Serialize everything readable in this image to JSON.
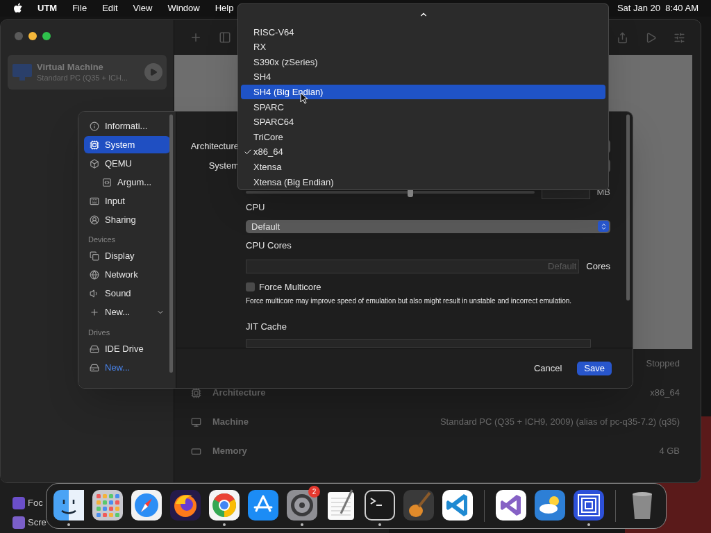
{
  "menu_bar": {
    "app": "UTM",
    "menus": [
      "File",
      "Edit",
      "View",
      "Window",
      "Help"
    ],
    "clock": "Sat Jan 20  8:40 AM"
  },
  "vm_list": [
    {
      "name": "Virtual Machine",
      "subtitle": "Standard PC (Q35 + ICH...",
      "selected": true
    }
  ],
  "vm_details": {
    "status": "Stopped",
    "rows": [
      {
        "kind": "chip",
        "label": "Architecture",
        "value": "x86_64"
      },
      {
        "kind": "monitor",
        "label": "Machine",
        "value": "Standard PC (Q35 + ICH9, 2009) (alias of pc-q35-7.2) (q35)"
      },
      {
        "kind": "memory",
        "label": "Memory",
        "value": "4 GB"
      }
    ]
  },
  "settings_sidebar": [
    {
      "items": [
        {
          "kind": "info",
          "label": "Informati...",
          "selected": false
        },
        {
          "kind": "chip",
          "label": "System",
          "selected": true
        },
        {
          "kind": "cube",
          "label": "QEMU",
          "selected": false,
          "children": [
            {
              "kind": "args",
              "label": "Argum...",
              "selected": false
            }
          ]
        },
        {
          "kind": "keyboard",
          "label": "Input",
          "selected": false
        },
        {
          "kind": "person",
          "label": "Sharing",
          "selected": false
        }
      ]
    },
    {
      "header": "Devices",
      "items": [
        {
          "kind": "display",
          "label": "Display",
          "selected": false
        },
        {
          "kind": "globe",
          "label": "Network",
          "selected": false
        },
        {
          "kind": "speaker",
          "label": "Sound",
          "selected": false
        },
        {
          "kind": "plus",
          "label": "New...",
          "selected": false,
          "menu": true
        }
      ]
    },
    {
      "header": "Drives",
      "items": [
        {
          "kind": "drive",
          "label": "IDE Drive",
          "selected": false
        },
        {
          "kind": "drive",
          "label": "New...",
          "selected": false,
          "link": true
        }
      ]
    }
  ],
  "form": {
    "architecture_label": "Architecture",
    "system_label": "System",
    "memory": {
      "unit": "MB",
      "level": 0.57
    },
    "cpu": {
      "label": "CPU",
      "value": "Default"
    },
    "cpu_cores": {
      "label": "CPU Cores",
      "placeholder": "Default",
      "unit": "Cores"
    },
    "force_multicore": {
      "label": "Force Multicore",
      "checked": false,
      "description": "Force multicore may improve speed of emulation but also might result in unstable and incorrect emulation."
    },
    "jit_cache": {
      "label": "JIT Cache"
    }
  },
  "buttons": {
    "cancel": "Cancel",
    "save": "Save"
  },
  "arch_menu": {
    "items": [
      {
        "label": "RISC-V64",
        "selected": false,
        "checked": false
      },
      {
        "label": "RX",
        "selected": false,
        "checked": false
      },
      {
        "label": "S390x (zSeries)",
        "selected": false,
        "checked": false
      },
      {
        "label": "SH4",
        "selected": false,
        "checked": false
      },
      {
        "label": "SH4 (Big Endian)",
        "selected": true,
        "checked": false
      },
      {
        "label": "SPARC",
        "selected": false,
        "checked": false
      },
      {
        "label": "SPARC64",
        "selected": false,
        "checked": false
      },
      {
        "label": "TriCore",
        "selected": false,
        "checked": false
      },
      {
        "label": "x86_64",
        "selected": false,
        "checked": true
      },
      {
        "label": "Xtensa",
        "selected": false,
        "checked": false
      },
      {
        "label": "Xtensa (Big Endian)",
        "selected": false,
        "checked": false
      }
    ]
  },
  "background_window": {
    "items": [
      {
        "label": "Foc",
        "color": "#6b4fc9"
      },
      {
        "label": "Scre",
        "color": "#7b5fc9"
      }
    ]
  },
  "dock": [
    {
      "kind": "finder",
      "running": true
    },
    {
      "kind": "launchpad",
      "running": false
    },
    {
      "kind": "safari",
      "running": false
    },
    {
      "kind": "firefox",
      "running": false
    },
    {
      "kind": "chrome",
      "running": true
    },
    {
      "kind": "appstore",
      "running": false
    },
    {
      "kind": "settings",
      "running": true,
      "badge": "2"
    },
    {
      "kind": "textedit",
      "running": false
    },
    {
      "kind": "terminal",
      "running": true
    },
    {
      "kind": "guitar",
      "running": false
    },
    {
      "kind": "vscode",
      "running": false
    },
    {
      "kind": "separator"
    },
    {
      "kind": "visualstudio",
      "running": false
    },
    {
      "kind": "weather",
      "running": false
    },
    {
      "kind": "squares",
      "running": true
    },
    {
      "kind": "separator"
    },
    {
      "kind": "trash",
      "running": false
    }
  ]
}
